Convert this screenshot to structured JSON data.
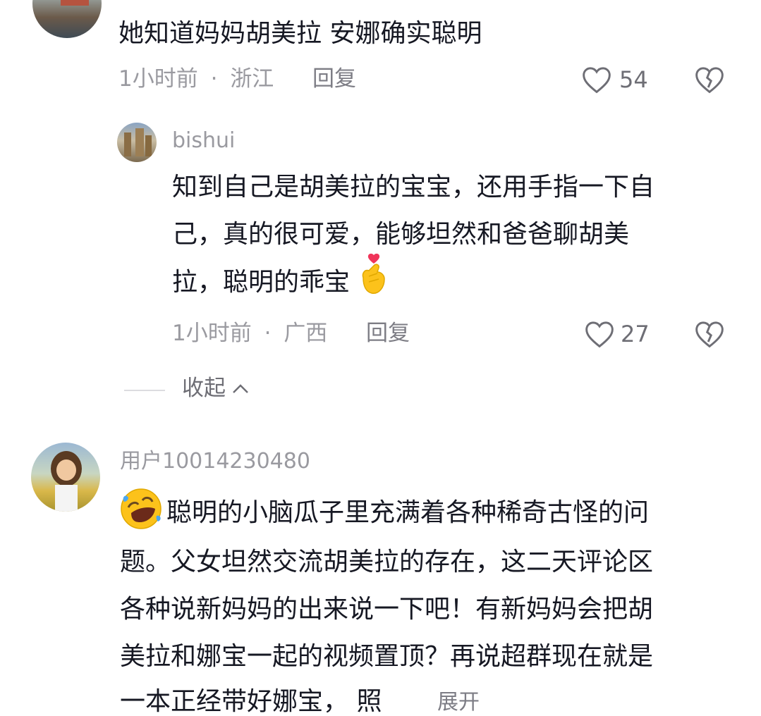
{
  "comment1": {
    "text": "她知道妈妈胡美拉 安娜确实聪明",
    "time": "1小时前",
    "region": "浙江",
    "reply_label": "回复",
    "likes": "54"
  },
  "reply1": {
    "username": "bishui",
    "lines": [
      "知到自己是胡美拉的宝宝，还用手指一下自",
      "己，真的很可爱，能够坦然和爸爸聊胡美",
      "拉，聪明的乖宝"
    ],
    "time": "1小时前",
    "region": "广西",
    "reply_label": "回复",
    "likes": "27"
  },
  "collapse": {
    "label": "收起"
  },
  "comment2": {
    "username": "用户10014230480",
    "lines": [
      "聪明的小脑瓜子里充满着各种稀奇古怪的问",
      "题。父女坦然交流胡美拉的存在，这二天评论区",
      "各种说新妈妈的出来说一下吧！有新妈妈会把胡",
      "美拉和娜宝一起的视频置顶？再说超群现在就是",
      "一本正经带好娜宝，   照"
    ],
    "expand_label": "展开"
  },
  "separator": "·",
  "icons": {
    "like": "heart-outline-icon",
    "dislike": "broken-heart-icon",
    "collapse": "chevron-up-icon",
    "emoji_finger_heart": "finger-heart-emoji",
    "emoji_laugh": "rolling-laugh-emoji"
  }
}
